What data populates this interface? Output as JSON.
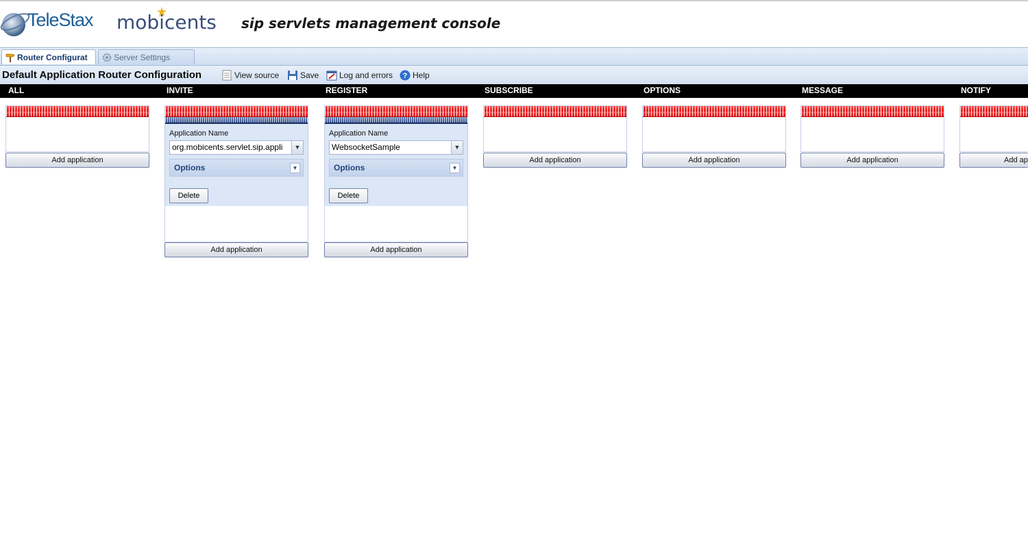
{
  "header": {
    "telestax_logo": "TeleStax",
    "mobicents_logo": "mobicents",
    "console_title": "sip servlets management console"
  },
  "tabs": [
    {
      "label": "Router Configurat",
      "active": true,
      "icon": "router-icon"
    },
    {
      "label": "Server Settings",
      "active": false,
      "icon": "gear-icon"
    }
  ],
  "toolbar": {
    "title": "Default Application Router Configuration",
    "view_source": "View source",
    "save": "Save",
    "log": "Log and errors",
    "help": "Help"
  },
  "columns": [
    {
      "name": "ALL"
    },
    {
      "name": "INVITE",
      "app_label": "Application Name",
      "app_value": "org.mobicents.servlet.sip.appli",
      "options": "Options",
      "delete": "Delete"
    },
    {
      "name": "REGISTER",
      "app_label": "Application Name",
      "app_value": "WebsocketSample",
      "options": "Options",
      "delete": "Delete"
    },
    {
      "name": "SUBSCRIBE"
    },
    {
      "name": "OPTIONS"
    },
    {
      "name": "MESSAGE"
    },
    {
      "name": "NOTIFY"
    }
  ],
  "add_application_label": "Add application",
  "add_application_partial": "Add ap",
  "colors": {
    "tab_bar": "#cfdff3",
    "column_header_bg": "#000000",
    "stripe_red": "#e01818",
    "app_block_bg": "#dbe6f6"
  }
}
